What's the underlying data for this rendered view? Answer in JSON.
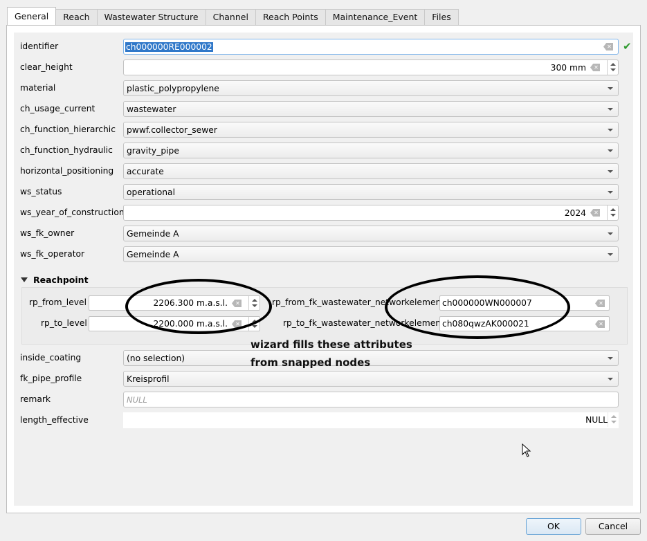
{
  "tabs": [
    {
      "label": "General",
      "active": true
    },
    {
      "label": "Reach",
      "active": false
    },
    {
      "label": "Wastewater Structure",
      "active": false
    },
    {
      "label": "Channel",
      "active": false
    },
    {
      "label": "Reach Points",
      "active": false
    },
    {
      "label": "Maintenance_Event",
      "active": false
    },
    {
      "label": "Files",
      "active": false
    }
  ],
  "fields": {
    "identifier": {
      "label": "identifier",
      "value": "ch000000RE000002"
    },
    "clear_height": {
      "label": "clear_height",
      "value": "300 mm"
    },
    "material": {
      "label": "material",
      "value": "plastic_polypropylene"
    },
    "ch_usage_current": {
      "label": "ch_usage_current",
      "value": "wastewater"
    },
    "ch_function_hierarchic": {
      "label": "ch_function_hierarchic",
      "value": "pwwf.collector_sewer"
    },
    "ch_function_hydraulic": {
      "label": "ch_function_hydraulic",
      "value": "gravity_pipe"
    },
    "horizontal_positioning": {
      "label": "horizontal_positioning",
      "value": "accurate"
    },
    "ws_status": {
      "label": "ws_status",
      "value": "operational"
    },
    "ws_year_of_construction": {
      "label": "ws_year_of_construction",
      "value": "2024"
    },
    "ws_fk_owner": {
      "label": "ws_fk_owner",
      "value": "Gemeinde A"
    },
    "ws_fk_operator": {
      "label": "ws_fk_operator",
      "value": "Gemeinde A"
    },
    "inside_coating": {
      "label": "inside_coating",
      "value": "(no selection)"
    },
    "fk_pipe_profile": {
      "label": "fk_pipe_profile",
      "value": "Kreisprofil"
    },
    "remark": {
      "label": "remark",
      "placeholder": "NULL"
    },
    "length_effective": {
      "label": "length_effective",
      "value": "NULL"
    }
  },
  "reachpoint": {
    "title": "Reachpoint",
    "rp_from_level": {
      "label": "rp_from_level",
      "value": "2206.300 m.a.s.l."
    },
    "rp_to_level": {
      "label": "rp_to_level",
      "value": "2200.000 m.a.s.l."
    },
    "rp_from_fk": {
      "label": "rp_from_fk_wastewater_networkelement",
      "value": "ch000000WN000007"
    },
    "rp_to_fk": {
      "label": "rp_to_fk_wastewater_networkelement",
      "value": "ch080qwzAK000021"
    }
  },
  "annotation": {
    "line1": "wizard fills these attributes",
    "line2": "from snapped nodes"
  },
  "buttons": {
    "ok": "OK",
    "cancel": "Cancel"
  },
  "colors": {
    "valid_check": "#2e9a2e",
    "selection": "#3078c9"
  }
}
